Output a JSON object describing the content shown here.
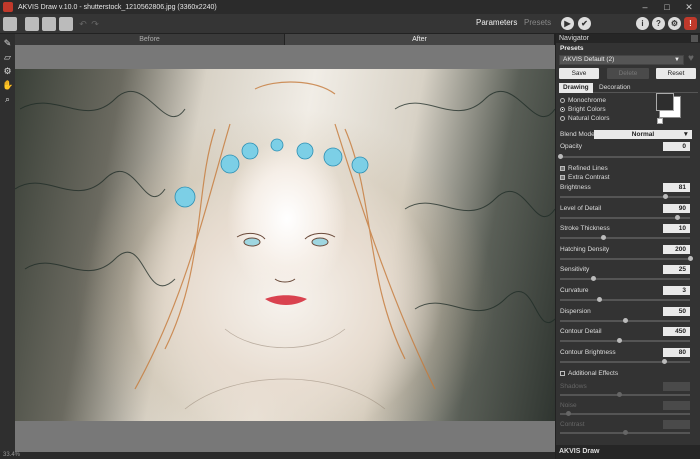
{
  "window": {
    "title": "AKVIS Draw v.10.0 - shutterstock_1210562806.jpg (3360x2240)",
    "controls": [
      "–",
      "□",
      "✕"
    ]
  },
  "toolbar": {
    "tabs": [
      "Parameters",
      "Presets"
    ],
    "active_tab": "Parameters",
    "undo": "↶",
    "redo": "↷",
    "run": "▶",
    "apply": "✔",
    "info": "i",
    "help": "?",
    "settings": "⚙",
    "hint": "!"
  },
  "tools": [
    "✎",
    "▱",
    "⚙",
    "✋",
    "⌕"
  ],
  "canvas": {
    "tabs": [
      "Before",
      "After"
    ],
    "active_tab": "After",
    "zoom": "33.4%"
  },
  "panel": {
    "navigator": "Navigator",
    "presets_label": "Presets",
    "preset_value": "AKVIS Default (2)",
    "buttons": {
      "save": "Save",
      "delete": "Delete",
      "reset": "Reset"
    },
    "tabs": [
      "Drawing",
      "Decoration"
    ],
    "active_tab": "Drawing",
    "color_modes": [
      "Monochrome",
      "Bright Colors",
      "Natural Colors"
    ],
    "selected_mode": "Bright Colors",
    "blend_label": "Blend Mode",
    "blend_value": "Normal",
    "opacity": {
      "label": "Opacity",
      "value": 0
    },
    "refined_lines": "Refined Lines",
    "extra_contrast": "Extra Contrast",
    "params": [
      {
        "label": "Brightness",
        "value": 81,
        "max": 100
      },
      {
        "label": "Level of Detail",
        "value": 90,
        "max": 100
      },
      {
        "label": "Stroke Thickness",
        "value": 10,
        "max": 30
      },
      {
        "label": "Hatching Density",
        "value": 200,
        "max": 200
      },
      {
        "label": "Sensitivity",
        "value": 25,
        "max": 100
      },
      {
        "label": "Curvature",
        "value": 3,
        "max": 10
      },
      {
        "label": "Dispersion",
        "value": 50,
        "max": 100
      },
      {
        "label": "Contour Detail",
        "value": 450,
        "max": 1000
      },
      {
        "label": "Contour Brightness",
        "value": 80,
        "max": 100
      }
    ],
    "additional_effects": "Additional Effects",
    "disabled_params": [
      {
        "label": "Shadows",
        "value": "",
        "level": 0.45
      },
      {
        "label": "Noise",
        "value": "",
        "level": 0.06
      },
      {
        "label": "Contrast",
        "value": "",
        "level": 0.5
      }
    ],
    "footer": "AKVIS Draw"
  }
}
